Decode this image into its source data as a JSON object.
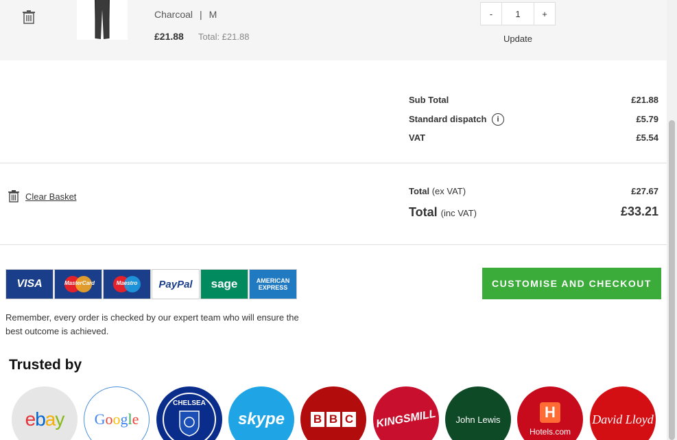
{
  "item": {
    "colour": "Charcoal",
    "separator": "|",
    "size": "M",
    "price": "£21.88",
    "line_total": "Total: £21.88",
    "quantity": "1",
    "qty_minus": "-",
    "qty_plus": "+",
    "update_label": "Update"
  },
  "summary": {
    "sub_total_label": "Sub Total",
    "sub_total_value": "£21.88",
    "dispatch_label": "Standard dispatch",
    "dispatch_value": "£5.79",
    "vat_label": "VAT",
    "vat_value": "£5.54",
    "info_glyph": "i"
  },
  "basket": {
    "clear_label": "Clear Basket"
  },
  "totals": {
    "ex_label": "Total",
    "ex_suffix": "(ex VAT)",
    "ex_value": "£27.67",
    "inc_label": "Total",
    "inc_suffix": "(inc VAT)",
    "inc_value": "£33.21"
  },
  "payments": {
    "visa": "VISA",
    "mastercard": "MasterCard",
    "maestro": "Maestro",
    "paypal": "PayPal",
    "sage": "sage",
    "amex": "AMERICAN EXPRESS"
  },
  "note": "Remember, every order is checked by our expert team who will ensure the best outcome is achieved.",
  "checkout_label": "CUSTOMISE AND CHECKOUT",
  "trusted": {
    "heading": "Trusted by",
    "logos": [
      "ebay",
      "Google",
      "CHELSEA",
      "skype",
      "BBC",
      "KINGSMILL",
      "John Lewis",
      "Hotels.com",
      "David Lloyd"
    ]
  },
  "colors": {
    "checkout_green": "#3bab3a",
    "row_background": "#f5f5f5"
  }
}
